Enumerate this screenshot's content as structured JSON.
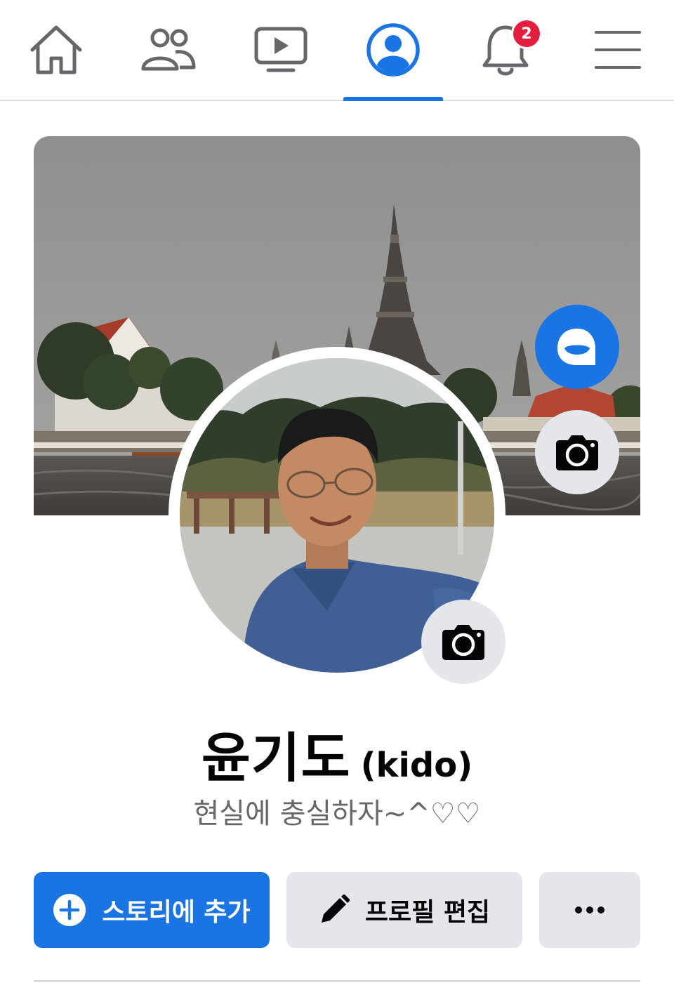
{
  "nav": {
    "items": [
      {
        "icon": "home-icon"
      },
      {
        "icon": "friends-icon"
      },
      {
        "icon": "watch-icon"
      },
      {
        "icon": "profile-icon",
        "active": true
      },
      {
        "icon": "bell-icon",
        "badge": "2"
      },
      {
        "icon": "menu-icon"
      }
    ],
    "notification_badge": "2"
  },
  "profile": {
    "name": "윤기도",
    "alt_name": "(kido)",
    "bio": "현실에 충실하자~^♡♡"
  },
  "actions": {
    "add_story_label": "스토리에 추가",
    "edit_profile_label": "프로필 편집"
  },
  "colors": {
    "accent": "#1b74e4",
    "badge": "#e41e3f",
    "secondary_button": "#e4e6eb",
    "muted_text": "#65676b"
  }
}
